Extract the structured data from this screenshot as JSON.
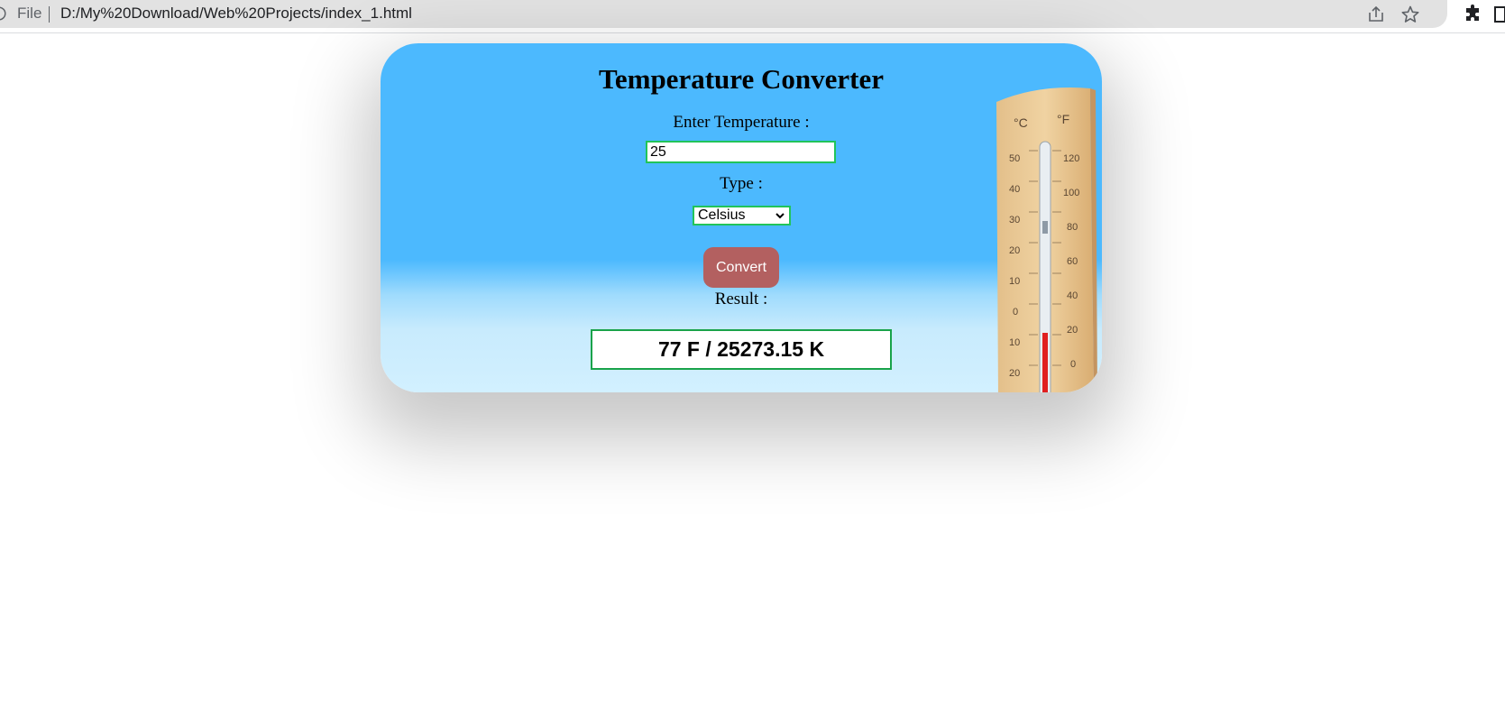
{
  "browser": {
    "file_label": "File",
    "url": "D:/My%20Download/Web%20Projects/index_1.html",
    "icons": [
      "info-icon",
      "share-icon",
      "star-icon",
      "extensions-icon",
      "side-panel-icon"
    ]
  },
  "converter": {
    "title": "Temperature Converter",
    "input_label": "Enter Temperature :",
    "input_value": "25",
    "type_label": "Type :",
    "type_selected": "Celsius",
    "convert_label": "Convert",
    "result_label": "Result :",
    "result_value": "77 F / 25273.15 K",
    "thermometer": {
      "celsius_unit": "°C",
      "fahrenheit_unit": "°F",
      "celsius_ticks": [
        "50",
        "40",
        "30",
        "20",
        "10",
        "0",
        "10",
        "20"
      ],
      "fahrenheit_ticks": [
        "120",
        "100",
        "80",
        "60",
        "40",
        "20",
        "0"
      ]
    },
    "colors": {
      "card_top": "#4cb9fe",
      "card_bottom": "#d2f0ff",
      "button": "#b36060",
      "border_green": "#21c45a"
    }
  }
}
